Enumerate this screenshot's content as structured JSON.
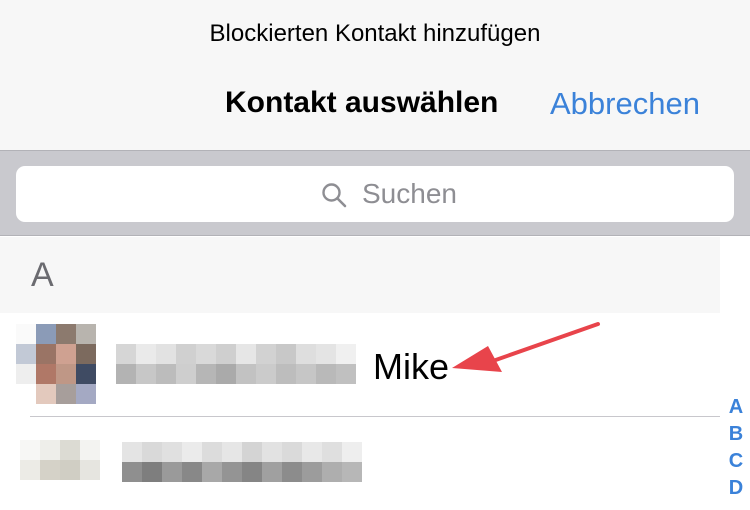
{
  "header": {
    "prompt": "Blockierten Kontakt hinzufügen",
    "title": "Kontakt auswählen",
    "cancel_label": "Abbrechen"
  },
  "search": {
    "placeholder": "Suchen",
    "icon": "search-icon"
  },
  "section": {
    "letter": "A"
  },
  "contacts": [
    {
      "name": "Mike",
      "name_prefix_redacted": true
    },
    {
      "name": "",
      "name_prefix_redacted": true
    }
  ],
  "index_letters": [
    "A",
    "B",
    "C",
    "D"
  ],
  "colors": {
    "accent": "#3b82d9",
    "annotation_arrow": "#e8444b"
  }
}
